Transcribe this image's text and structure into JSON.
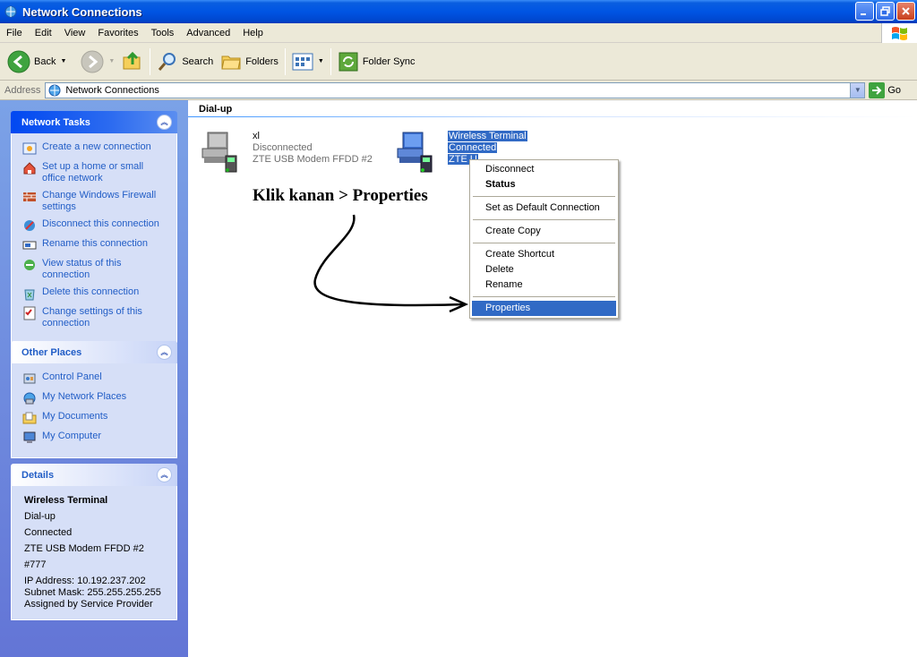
{
  "window": {
    "title": "Network Connections"
  },
  "menu": [
    "File",
    "Edit",
    "View",
    "Favorites",
    "Tools",
    "Advanced",
    "Help"
  ],
  "toolbar": {
    "back": "Back",
    "search": "Search",
    "folders": "Folders",
    "folder_sync": "Folder Sync"
  },
  "address": {
    "label": "Address",
    "value": "Network Connections",
    "go": "Go"
  },
  "network_tasks": {
    "title": "Network Tasks",
    "items": [
      "Create a new connection",
      "Set up a home or small office network",
      "Change Windows Firewall settings",
      "Disconnect this connection",
      "Rename this connection",
      "View status of this connection",
      "Delete this connection",
      "Change settings of this connection"
    ]
  },
  "other_places": {
    "title": "Other Places",
    "items": [
      "Control Panel",
      "My Network Places",
      "My Documents",
      "My Computer"
    ]
  },
  "details": {
    "title": "Details",
    "name": "Wireless Terminal",
    "type": "Dial-up",
    "status": "Connected",
    "device": "ZTE USB Modem FFDD #2",
    "number": "#777",
    "ip": "IP Address: 10.192.237.202",
    "subnet": "Subnet Mask: 255.255.255.255",
    "assigned": "Assigned by Service Provider"
  },
  "group": {
    "title": "Dial-up"
  },
  "connections": [
    {
      "name": "xl",
      "status": "Disconnected",
      "device": "ZTE USB Modem FFDD #2"
    },
    {
      "name": "Wireless Terminal",
      "status": "Connected",
      "device": "ZTE U"
    }
  ],
  "annotation": "Klik kanan > Properties",
  "context_menu": {
    "disconnect": "Disconnect",
    "status": "Status",
    "set_default": "Set as Default Connection",
    "create_copy": "Create Copy",
    "create_shortcut": "Create Shortcut",
    "delete": "Delete",
    "rename": "Rename",
    "properties": "Properties"
  },
  "colors": {
    "title_bar": "#0054e3",
    "selection": "#316ac5",
    "task_link": "#215dc6",
    "pane_top": "#7ba2e7",
    "pane_bottom": "#6375d6"
  }
}
